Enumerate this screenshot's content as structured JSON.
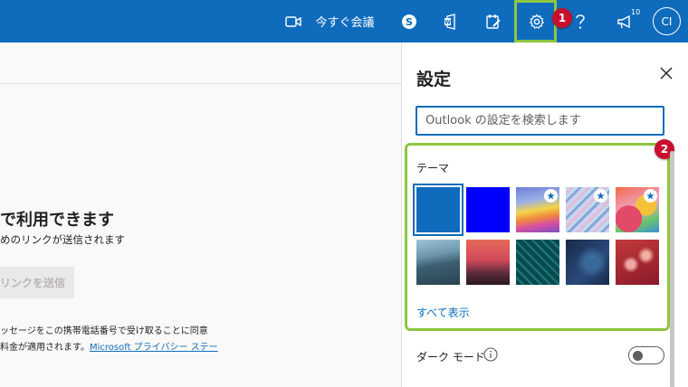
{
  "topbar": {
    "meet_now_label": "今すぐ会議",
    "notification_count": "10",
    "avatar_initials": "CI",
    "brand_color": "#0f6cbd",
    "icons": [
      "video-icon",
      "skype-icon",
      "office-icon",
      "my-day-icon",
      "gear-icon",
      "help-icon",
      "megaphone-icon"
    ]
  },
  "annotations": {
    "step1": "1",
    "step2": "2",
    "highlight_color": "#8ec641",
    "badge_color": "#c8102e"
  },
  "main": {
    "headline": "で利用できます",
    "subtext": "めのリンクが送信されます",
    "send_button": "リンクを送信",
    "legal_line1": "ッセージをこの携帯電話番号で受け取ることに同意",
    "legal_line2_prefix": "料金が適用されます。",
    "legal_link": "Microsoft プライバシー ステー"
  },
  "settings": {
    "title": "設定",
    "search_placeholder": "Outlook の設定を検索します",
    "theme_label": "テーマ",
    "themes": [
      {
        "name": "blue",
        "selected": true
      },
      {
        "name": "bright-blue",
        "selected": false
      },
      {
        "name": "rainbow-waves",
        "selected": false,
        "premium": true
      },
      {
        "name": "rainbow-stripes",
        "selected": false,
        "premium": true
      },
      {
        "name": "colorful-art",
        "selected": false,
        "premium": true
      },
      {
        "name": "mountain",
        "selected": false
      },
      {
        "name": "palm-sunset",
        "selected": false
      },
      {
        "name": "circuit",
        "selected": false
      },
      {
        "name": "space-text",
        "selected": false
      },
      {
        "name": "bokeh",
        "selected": false
      }
    ],
    "show_all": "すべて表示",
    "dark_mode_label": "ダーク モード",
    "dark_mode_on": false
  }
}
